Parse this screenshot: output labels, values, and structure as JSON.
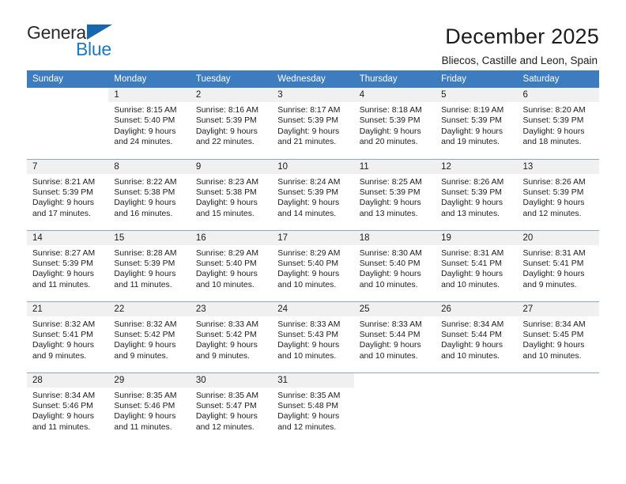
{
  "logo": {
    "word_one": "General",
    "word_two": "Blue",
    "triangle_icon": "triangle-icon",
    "brand_blue": "#1b7ac4",
    "triangle_blue": "#1666b0"
  },
  "header": {
    "month_title": "December 2025",
    "location": "Bliecos, Castille and Leon, Spain",
    "header_blue": "#3d7dbf",
    "daynum_bg": "#f0f0f0"
  },
  "weekdays": [
    "Sunday",
    "Monday",
    "Tuesday",
    "Wednesday",
    "Thursday",
    "Friday",
    "Saturday"
  ],
  "weeks": [
    [
      {
        "day": "",
        "sunrise": "",
        "sunset": "",
        "daylight1": "",
        "daylight2": ""
      },
      {
        "day": "1",
        "sunrise": "Sunrise: 8:15 AM",
        "sunset": "Sunset: 5:40 PM",
        "daylight1": "Daylight: 9 hours",
        "daylight2": "and 24 minutes."
      },
      {
        "day": "2",
        "sunrise": "Sunrise: 8:16 AM",
        "sunset": "Sunset: 5:39 PM",
        "daylight1": "Daylight: 9 hours",
        "daylight2": "and 22 minutes."
      },
      {
        "day": "3",
        "sunrise": "Sunrise: 8:17 AM",
        "sunset": "Sunset: 5:39 PM",
        "daylight1": "Daylight: 9 hours",
        "daylight2": "and 21 minutes."
      },
      {
        "day": "4",
        "sunrise": "Sunrise: 8:18 AM",
        "sunset": "Sunset: 5:39 PM",
        "daylight1": "Daylight: 9 hours",
        "daylight2": "and 20 minutes."
      },
      {
        "day": "5",
        "sunrise": "Sunrise: 8:19 AM",
        "sunset": "Sunset: 5:39 PM",
        "daylight1": "Daylight: 9 hours",
        "daylight2": "and 19 minutes."
      },
      {
        "day": "6",
        "sunrise": "Sunrise: 8:20 AM",
        "sunset": "Sunset: 5:39 PM",
        "daylight1": "Daylight: 9 hours",
        "daylight2": "and 18 minutes."
      }
    ],
    [
      {
        "day": "7",
        "sunrise": "Sunrise: 8:21 AM",
        "sunset": "Sunset: 5:39 PM",
        "daylight1": "Daylight: 9 hours",
        "daylight2": "and 17 minutes."
      },
      {
        "day": "8",
        "sunrise": "Sunrise: 8:22 AM",
        "sunset": "Sunset: 5:38 PM",
        "daylight1": "Daylight: 9 hours",
        "daylight2": "and 16 minutes."
      },
      {
        "day": "9",
        "sunrise": "Sunrise: 8:23 AM",
        "sunset": "Sunset: 5:38 PM",
        "daylight1": "Daylight: 9 hours",
        "daylight2": "and 15 minutes."
      },
      {
        "day": "10",
        "sunrise": "Sunrise: 8:24 AM",
        "sunset": "Sunset: 5:39 PM",
        "daylight1": "Daylight: 9 hours",
        "daylight2": "and 14 minutes."
      },
      {
        "day": "11",
        "sunrise": "Sunrise: 8:25 AM",
        "sunset": "Sunset: 5:39 PM",
        "daylight1": "Daylight: 9 hours",
        "daylight2": "and 13 minutes."
      },
      {
        "day": "12",
        "sunrise": "Sunrise: 8:26 AM",
        "sunset": "Sunset: 5:39 PM",
        "daylight1": "Daylight: 9 hours",
        "daylight2": "and 13 minutes."
      },
      {
        "day": "13",
        "sunrise": "Sunrise: 8:26 AM",
        "sunset": "Sunset: 5:39 PM",
        "daylight1": "Daylight: 9 hours",
        "daylight2": "and 12 minutes."
      }
    ],
    [
      {
        "day": "14",
        "sunrise": "Sunrise: 8:27 AM",
        "sunset": "Sunset: 5:39 PM",
        "daylight1": "Daylight: 9 hours",
        "daylight2": "and 11 minutes."
      },
      {
        "day": "15",
        "sunrise": "Sunrise: 8:28 AM",
        "sunset": "Sunset: 5:39 PM",
        "daylight1": "Daylight: 9 hours",
        "daylight2": "and 11 minutes."
      },
      {
        "day": "16",
        "sunrise": "Sunrise: 8:29 AM",
        "sunset": "Sunset: 5:40 PM",
        "daylight1": "Daylight: 9 hours",
        "daylight2": "and 10 minutes."
      },
      {
        "day": "17",
        "sunrise": "Sunrise: 8:29 AM",
        "sunset": "Sunset: 5:40 PM",
        "daylight1": "Daylight: 9 hours",
        "daylight2": "and 10 minutes."
      },
      {
        "day": "18",
        "sunrise": "Sunrise: 8:30 AM",
        "sunset": "Sunset: 5:40 PM",
        "daylight1": "Daylight: 9 hours",
        "daylight2": "and 10 minutes."
      },
      {
        "day": "19",
        "sunrise": "Sunrise: 8:31 AM",
        "sunset": "Sunset: 5:41 PM",
        "daylight1": "Daylight: 9 hours",
        "daylight2": "and 10 minutes."
      },
      {
        "day": "20",
        "sunrise": "Sunrise: 8:31 AM",
        "sunset": "Sunset: 5:41 PM",
        "daylight1": "Daylight: 9 hours",
        "daylight2": "and 9 minutes."
      }
    ],
    [
      {
        "day": "21",
        "sunrise": "Sunrise: 8:32 AM",
        "sunset": "Sunset: 5:41 PM",
        "daylight1": "Daylight: 9 hours",
        "daylight2": "and 9 minutes."
      },
      {
        "day": "22",
        "sunrise": "Sunrise: 8:32 AM",
        "sunset": "Sunset: 5:42 PM",
        "daylight1": "Daylight: 9 hours",
        "daylight2": "and 9 minutes."
      },
      {
        "day": "23",
        "sunrise": "Sunrise: 8:33 AM",
        "sunset": "Sunset: 5:42 PM",
        "daylight1": "Daylight: 9 hours",
        "daylight2": "and 9 minutes."
      },
      {
        "day": "24",
        "sunrise": "Sunrise: 8:33 AM",
        "sunset": "Sunset: 5:43 PM",
        "daylight1": "Daylight: 9 hours",
        "daylight2": "and 10 minutes."
      },
      {
        "day": "25",
        "sunrise": "Sunrise: 8:33 AM",
        "sunset": "Sunset: 5:44 PM",
        "daylight1": "Daylight: 9 hours",
        "daylight2": "and 10 minutes."
      },
      {
        "day": "26",
        "sunrise": "Sunrise: 8:34 AM",
        "sunset": "Sunset: 5:44 PM",
        "daylight1": "Daylight: 9 hours",
        "daylight2": "and 10 minutes."
      },
      {
        "day": "27",
        "sunrise": "Sunrise: 8:34 AM",
        "sunset": "Sunset: 5:45 PM",
        "daylight1": "Daylight: 9 hours",
        "daylight2": "and 10 minutes."
      }
    ],
    [
      {
        "day": "28",
        "sunrise": "Sunrise: 8:34 AM",
        "sunset": "Sunset: 5:46 PM",
        "daylight1": "Daylight: 9 hours",
        "daylight2": "and 11 minutes."
      },
      {
        "day": "29",
        "sunrise": "Sunrise: 8:35 AM",
        "sunset": "Sunset: 5:46 PM",
        "daylight1": "Daylight: 9 hours",
        "daylight2": "and 11 minutes."
      },
      {
        "day": "30",
        "sunrise": "Sunrise: 8:35 AM",
        "sunset": "Sunset: 5:47 PM",
        "daylight1": "Daylight: 9 hours",
        "daylight2": "and 12 minutes."
      },
      {
        "day": "31",
        "sunrise": "Sunrise: 8:35 AM",
        "sunset": "Sunset: 5:48 PM",
        "daylight1": "Daylight: 9 hours",
        "daylight2": "and 12 minutes."
      },
      {
        "day": "",
        "sunrise": "",
        "sunset": "",
        "daylight1": "",
        "daylight2": ""
      },
      {
        "day": "",
        "sunrise": "",
        "sunset": "",
        "daylight1": "",
        "daylight2": ""
      },
      {
        "day": "",
        "sunrise": "",
        "sunset": "",
        "daylight1": "",
        "daylight2": ""
      }
    ]
  ]
}
